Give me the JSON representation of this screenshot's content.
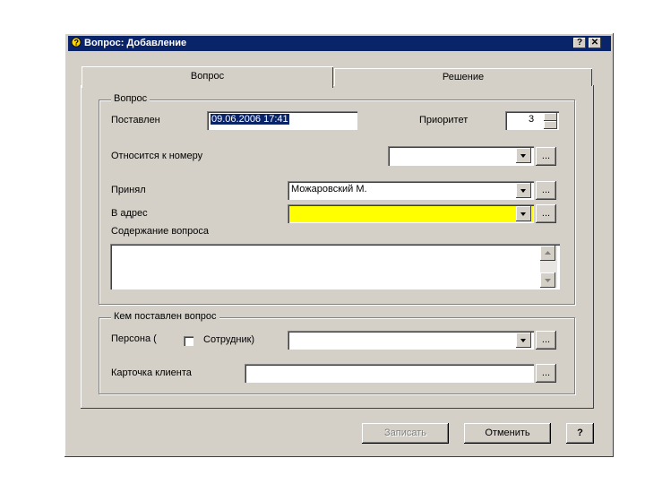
{
  "window": {
    "title": "Вопрос: Добавление",
    "help_btn": "?",
    "close_btn": "✕"
  },
  "tabs": [
    {
      "label": "Вопрос",
      "active": true
    },
    {
      "label": "Решение",
      "active": false
    }
  ],
  "group_question": {
    "legend": "Вопрос",
    "posted_label": "Поставлен",
    "posted_value": "09.06.2006 17:41",
    "priority_label": "Приоритет",
    "priority_value": "3",
    "relates_label": "Относится к номеру",
    "relates_value": "",
    "accepted_label": "Принял",
    "accepted_value": "Можаровский М.",
    "address_label": "В адрес",
    "address_value": "",
    "content_label": "Содержание вопроса",
    "content_value": "",
    "dots": "..."
  },
  "group_asker": {
    "legend": "Кем поставлен вопрос",
    "person_label": "Персона (",
    "employee_label": "Сотрудник)",
    "employee_checked": false,
    "person_value": "",
    "card_label": "Карточка клиента",
    "card_value": "",
    "dots": "..."
  },
  "buttons": {
    "save": "Записать",
    "cancel": "Отменить",
    "help": "?"
  },
  "colors": {
    "titlebar": "#0a246a",
    "face": "#d4d0c8",
    "highlight_field": "#ffff00"
  }
}
